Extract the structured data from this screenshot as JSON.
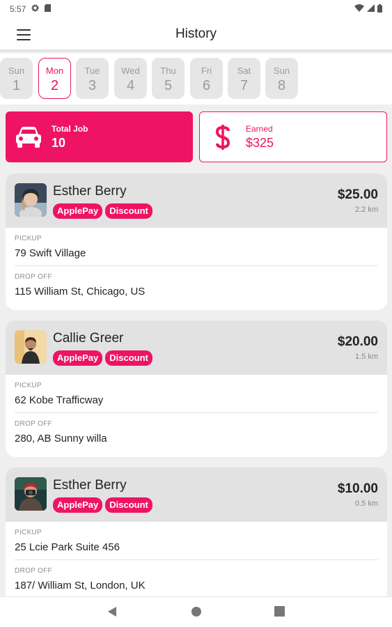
{
  "status_bar": {
    "time": "5:57"
  },
  "app_bar": {
    "title": "History"
  },
  "days": [
    {
      "name": "Sun",
      "num": "1",
      "active": false
    },
    {
      "name": "Mon",
      "num": "2",
      "active": true
    },
    {
      "name": "Tue",
      "num": "3",
      "active": false
    },
    {
      "name": "Wed",
      "num": "4",
      "active": false
    },
    {
      "name": "Thu",
      "num": "5",
      "active": false
    },
    {
      "name": "Fri",
      "num": "6",
      "active": false
    },
    {
      "name": "Sat",
      "num": "7",
      "active": false
    },
    {
      "name": "Sun",
      "num": "8",
      "active": false
    }
  ],
  "summary": {
    "total": {
      "label": "Total Job",
      "value": "10",
      "icon": "car-icon"
    },
    "earned": {
      "label": "Earned",
      "value": "$325",
      "icon": "dollar-icon"
    }
  },
  "jobs": [
    {
      "name": "Esther Berry",
      "tags": [
        "ApplePay",
        "Discount"
      ],
      "price": "$25.00",
      "distance": "2.2 km",
      "pickup_label": "PICKUP",
      "pickup": "79 Swift Village",
      "dropoff_label": "DROP OFF",
      "dropoff": "115 William St, Chicago, US"
    },
    {
      "name": "Callie Greer",
      "tags": [
        "ApplePay",
        "Discount"
      ],
      "price": "$20.00",
      "distance": "1.5 km",
      "pickup_label": "PICKUP",
      "pickup": "62 Kobe Trafficway",
      "dropoff_label": "DROP OFF",
      "dropoff": "280, AB Sunny willa"
    },
    {
      "name": "Esther Berry",
      "tags": [
        "ApplePay",
        "Discount"
      ],
      "price": "$10.00",
      "distance": "0.5 km",
      "pickup_label": "PICKUP",
      "pickup": "25 Lcie Park Suite 456",
      "dropoff_label": "DROP OFF",
      "dropoff": "187/ William St, London, UK"
    }
  ],
  "colors": {
    "accent": "#ee1463",
    "card_head": "#e2e2e2",
    "background": "#efefef"
  }
}
